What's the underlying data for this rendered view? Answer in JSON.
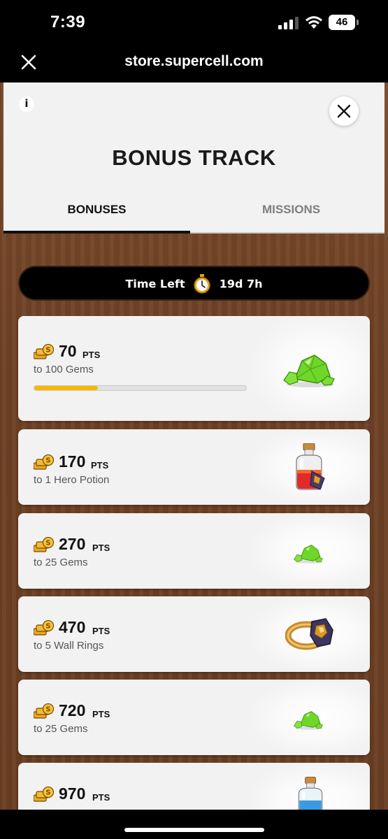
{
  "status_bar": {
    "time": "7:39",
    "battery": "46"
  },
  "browser": {
    "url": "store.supercell.com"
  },
  "modal": {
    "title": "BONUS TRACK",
    "tabs": [
      {
        "label": "BONUSES",
        "active": true
      },
      {
        "label": "MISSIONS",
        "active": false
      }
    ]
  },
  "timer": {
    "label": "Time Left",
    "value": "19d 7h"
  },
  "track_items": [
    {
      "points": "70",
      "unit": "PTS",
      "reward": "to 100 Gems",
      "reward_icon": "gems-icon",
      "progress_fraction": 0.3
    },
    {
      "points": "170",
      "unit": "PTS",
      "reward": "to 1 Hero Potion",
      "reward_icon": "hero-potion-icon"
    },
    {
      "points": "270",
      "unit": "PTS",
      "reward": "to 25 Gems",
      "reward_icon": "gems-icon"
    },
    {
      "points": "470",
      "unit": "PTS",
      "reward": "to 5 Wall Rings",
      "reward_icon": "wall-ring-icon"
    },
    {
      "points": "720",
      "unit": "PTS",
      "reward": "to 25 Gems",
      "reward_icon": "gems-icon"
    },
    {
      "points": "970",
      "unit": "PTS",
      "reward": "",
      "reward_icon": "potion-icon"
    }
  ],
  "colors": {
    "progress": "#f7b800",
    "accent_text": "#111111",
    "gem_green": "#6fd62a",
    "wood": "#6e4125"
  }
}
